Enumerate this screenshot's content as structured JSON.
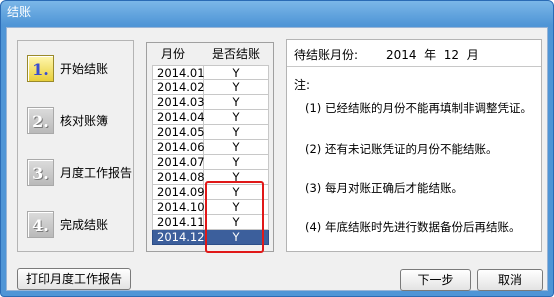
{
  "window": {
    "title": "结账"
  },
  "steps": [
    {
      "num": "1.",
      "label": "开始结账",
      "active": true
    },
    {
      "num": "2.",
      "label": "核对账簿",
      "active": false
    },
    {
      "num": "3.",
      "label": "月度工作报告",
      "active": false
    },
    {
      "num": "4.",
      "label": "完成结账",
      "active": false
    }
  ],
  "grid": {
    "headers": {
      "month": "月份",
      "status": "是否结账"
    },
    "rows": [
      {
        "month": "2014.01",
        "status": "Y"
      },
      {
        "month": "2014.02",
        "status": "Y"
      },
      {
        "month": "2014.03",
        "status": "Y"
      },
      {
        "month": "2014.04",
        "status": "Y"
      },
      {
        "month": "2014.05",
        "status": "Y"
      },
      {
        "month": "2014.06",
        "status": "Y"
      },
      {
        "month": "2014.07",
        "status": "Y"
      },
      {
        "month": "2014.08",
        "status": "Y"
      },
      {
        "month": "2014.09",
        "status": "Y"
      },
      {
        "month": "2014.10",
        "status": "Y"
      },
      {
        "month": "2014.11",
        "status": "Y"
      },
      {
        "month": "2014.12",
        "status": "Y"
      }
    ],
    "selected_month": "2014.12"
  },
  "info": {
    "pending_label": "待结账月份:",
    "pending_value": "2014  年  12  月",
    "note_title": "注:",
    "notes": [
      "(1) 已经结账的月份不能再填制非调整凭证。",
      "(2) 还有未记账凭证的月份不能结账。",
      "(3) 每月对账正确后才能结账。",
      "(4) 年底结账时先进行数据备份后再结账。"
    ]
  },
  "buttons": {
    "print_report": "打印月度工作报告",
    "next": "下一步",
    "cancel": "取消"
  },
  "colors": {
    "title_bar": "#4f95d6",
    "selected_row": "#3c5f9c",
    "annotation": "#e01818",
    "active_step": "#e8cf3a"
  }
}
